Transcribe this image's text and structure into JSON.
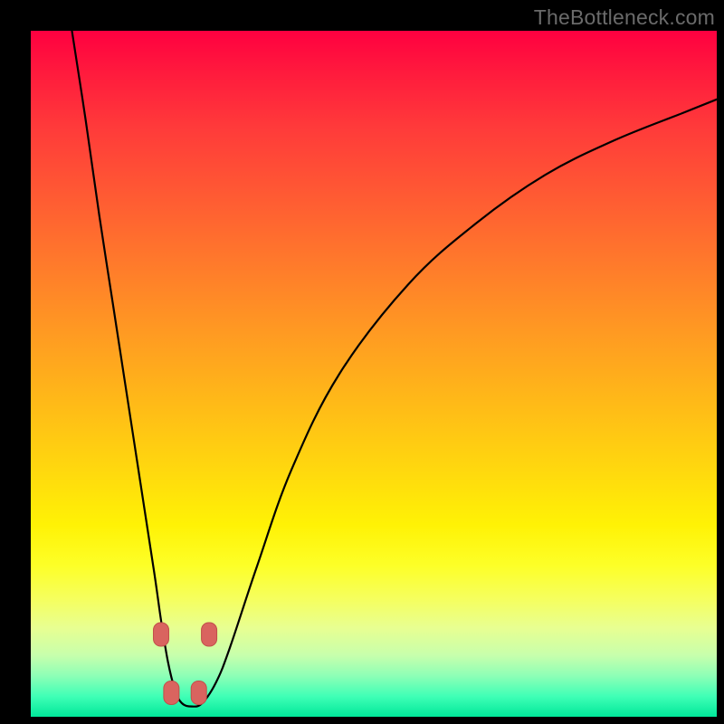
{
  "watermark": "TheBottleneck.com",
  "colors": {
    "frame": "#000000",
    "watermark": "#6a6a6a",
    "curve": "#000000",
    "marker_fill": "#d9645f",
    "marker_stroke": "#c14f4a"
  },
  "chart_data": {
    "type": "line",
    "title": "",
    "xlabel": "",
    "ylabel": "",
    "xlim": [
      0,
      100
    ],
    "ylim": [
      0,
      100
    ],
    "grid": false,
    "legend": false,
    "note": "Values are read from pixel positions; y=100 is top edge, y=0 is bottom edge of the gradient panel. x=0..100 spans the panel width.",
    "series": [
      {
        "name": "bottleneck-curve",
        "x": [
          6,
          8,
          10,
          12,
          14,
          16,
          18,
          19,
          20,
          21,
          22,
          23.5,
          25,
          27,
          29,
          33,
          38,
          45,
          55,
          65,
          75,
          85,
          95,
          100
        ],
        "y": [
          100,
          87,
          73,
          60,
          47,
          34,
          21,
          14,
          8,
          4,
          2,
          1.5,
          2,
          5,
          10,
          22,
          36,
          50,
          63,
          72,
          79,
          84,
          88,
          90
        ]
      }
    ],
    "markers": [
      {
        "x": 19.0,
        "y": 12.0
      },
      {
        "x": 20.5,
        "y": 3.5
      },
      {
        "x": 24.5,
        "y": 3.5
      },
      {
        "x": 26.0,
        "y": 12.0
      }
    ]
  }
}
